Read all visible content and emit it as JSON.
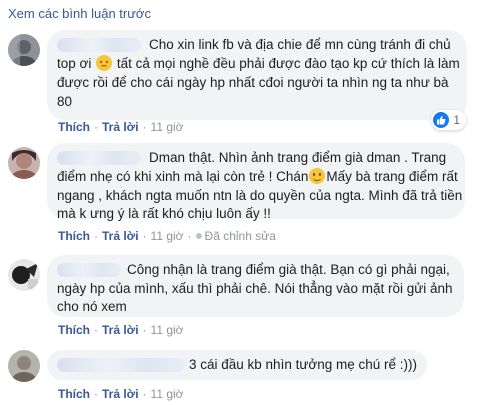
{
  "header": {
    "view_previous": "Xem các bình luận trước"
  },
  "actions": {
    "like": "Thích",
    "reply": "Trả lời"
  },
  "comments": [
    {
      "lines": [
        "Cho xin link fb và địa chie để mn cùng tránh đi chủ",
        "top ơi ",
        " tất cả mọi nghề đều phải được đào tạo kp cứ thích là làm",
        "được rồi để cho cái ngày hp nhất cđoi người ta nhìn ng ta như bà",
        "80"
      ],
      "time": "11 giờ",
      "reaction_count": "1"
    },
    {
      "lines": [
        "Dman thật. Nhìn ảnh trang điểm già dman . Trang",
        "điểm nhẹ có khi xinh mà lại còn trẻ ! Chán",
        "Mấy bà trang điểm rất",
        "ngang , khách ngta muốn ntn là do quyền của ngta. Mình đã trả tiền",
        "mà k ưng ý là rất khó chịu luôn ấy !!"
      ],
      "time": "11 giờ",
      "edited": "Đã chỉnh sửa"
    },
    {
      "lines": [
        "Công nhận là trang điểm già thật. Bạn có gì phải ngại,",
        "ngày hp của mình, xấu thì phải chê. Nói thẳng vào mặt rồi gửi ảnh",
        "cho nó xem"
      ],
      "time": "11 giờ"
    },
    {
      "lines": [
        "3 cái đầu kb nhìn tưởng mẹ chú rể :)))"
      ],
      "time": "11 giờ"
    }
  ],
  "colors": {
    "link": "#385898",
    "bubble": "#f2f3f5",
    "muted": "#90949c",
    "like_blue": "#1877f2"
  },
  "icons": [
    "sad-emoji-icon",
    "smile-emoji-icon",
    "like-reaction-icon",
    "edited-icon"
  ]
}
